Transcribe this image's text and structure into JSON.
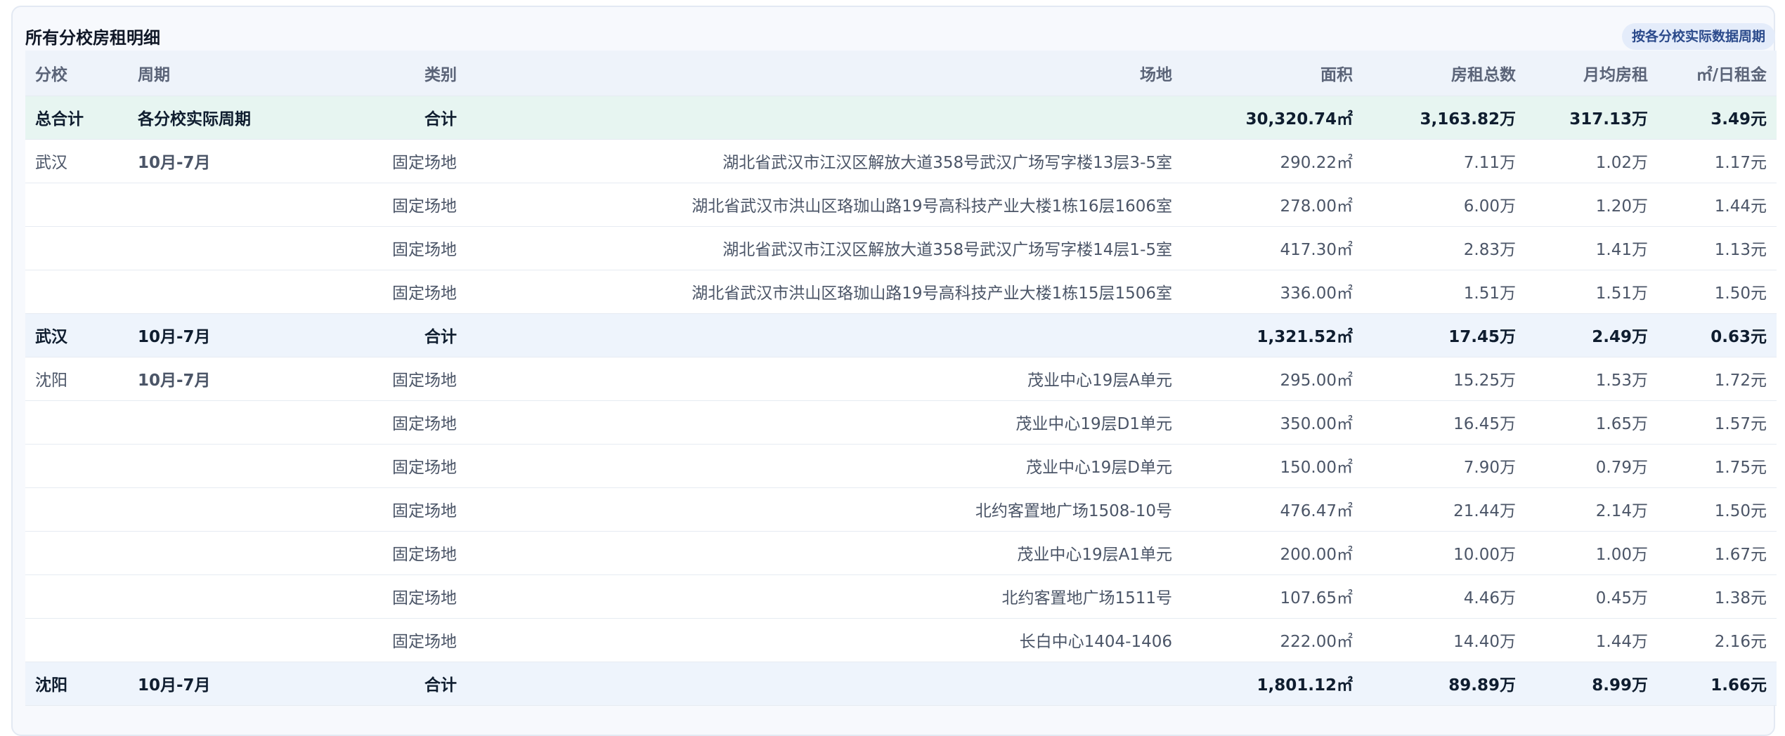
{
  "panel": {
    "title": "所有分校房租明细",
    "badge": "按各分校实际数据周期"
  },
  "table": {
    "headers": [
      "分校",
      "周期",
      "类别",
      "场地",
      "面积",
      "房租总数",
      "月均房租",
      "㎡/日租金"
    ],
    "grand_total": {
      "school": "总合计",
      "period": "各分校实际周期",
      "category": "合计",
      "venue": "",
      "area": "30,320.74㎡",
      "rent_total": "3,163.82万",
      "monthly_rent": "317.13万",
      "daily_rate": "3.49元"
    },
    "rows": [
      {
        "type": "body",
        "school": "武汉",
        "period": "10月-7月",
        "category": "固定场地",
        "venue": "湖北省武汉市江汉区解放大道358号武汉广场写字楼13层3-5室",
        "area": "290.22㎡",
        "rent_total": "7.11万",
        "monthly_rent": "1.02万",
        "daily_rate": "1.17元"
      },
      {
        "type": "body",
        "school": "",
        "period": "",
        "category": "固定场地",
        "venue": "湖北省武汉市洪山区珞珈山路19号高科技产业大楼1栋16层1606室",
        "area": "278.00㎡",
        "rent_total": "6.00万",
        "monthly_rent": "1.20万",
        "daily_rate": "1.44元"
      },
      {
        "type": "body",
        "school": "",
        "period": "",
        "category": "固定场地",
        "venue": "湖北省武汉市江汉区解放大道358号武汉广场写字楼14层1-5室",
        "area": "417.30㎡",
        "rent_total": "2.83万",
        "monthly_rent": "1.41万",
        "daily_rate": "1.13元"
      },
      {
        "type": "body",
        "school": "",
        "period": "",
        "category": "固定场地",
        "venue": "湖北省武汉市洪山区珞珈山路19号高科技产业大楼1栋15层1506室",
        "area": "336.00㎡",
        "rent_total": "1.51万",
        "monthly_rent": "1.51万",
        "daily_rate": "1.50元"
      },
      {
        "type": "subtotal",
        "school": "武汉",
        "period": "10月-7月",
        "category": "合计",
        "venue": "",
        "area": "1,321.52㎡",
        "rent_total": "17.45万",
        "monthly_rent": "2.49万",
        "daily_rate": "0.63元"
      },
      {
        "type": "body",
        "school": "沈阳",
        "period": "10月-7月",
        "category": "固定场地",
        "venue": "茂业中心19层A单元",
        "area": "295.00㎡",
        "rent_total": "15.25万",
        "monthly_rent": "1.53万",
        "daily_rate": "1.72元"
      },
      {
        "type": "body",
        "school": "",
        "period": "",
        "category": "固定场地",
        "venue": "茂业中心19层D1单元",
        "area": "350.00㎡",
        "rent_total": "16.45万",
        "monthly_rent": "1.65万",
        "daily_rate": "1.57元"
      },
      {
        "type": "body",
        "school": "",
        "period": "",
        "category": "固定场地",
        "venue": "茂业中心19层D单元",
        "area": "150.00㎡",
        "rent_total": "7.90万",
        "monthly_rent": "0.79万",
        "daily_rate": "1.75元"
      },
      {
        "type": "body",
        "school": "",
        "period": "",
        "category": "固定场地",
        "venue": "北约客置地广场1508-10号",
        "area": "476.47㎡",
        "rent_total": "21.44万",
        "monthly_rent": "2.14万",
        "daily_rate": "1.50元"
      },
      {
        "type": "body",
        "school": "",
        "period": "",
        "category": "固定场地",
        "venue": "茂业中心19层A1单元",
        "area": "200.00㎡",
        "rent_total": "10.00万",
        "monthly_rent": "1.00万",
        "daily_rate": "1.67元"
      },
      {
        "type": "body",
        "school": "",
        "period": "",
        "category": "固定场地",
        "venue": "北约客置地广场1511号",
        "area": "107.65㎡",
        "rent_total": "4.46万",
        "monthly_rent": "0.45万",
        "daily_rate": "1.38元"
      },
      {
        "type": "body",
        "school": "",
        "period": "",
        "category": "固定场地",
        "venue": "长白中心1404-1406",
        "area": "222.00㎡",
        "rent_total": "14.40万",
        "monthly_rent": "1.44万",
        "daily_rate": "2.16元"
      },
      {
        "type": "subtotal",
        "school": "沈阳",
        "period": "10月-7月",
        "category": "合计",
        "venue": "",
        "area": "1,801.12㎡",
        "rent_total": "89.89万",
        "monthly_rent": "8.99万",
        "daily_rate": "1.66元"
      }
    ]
  }
}
